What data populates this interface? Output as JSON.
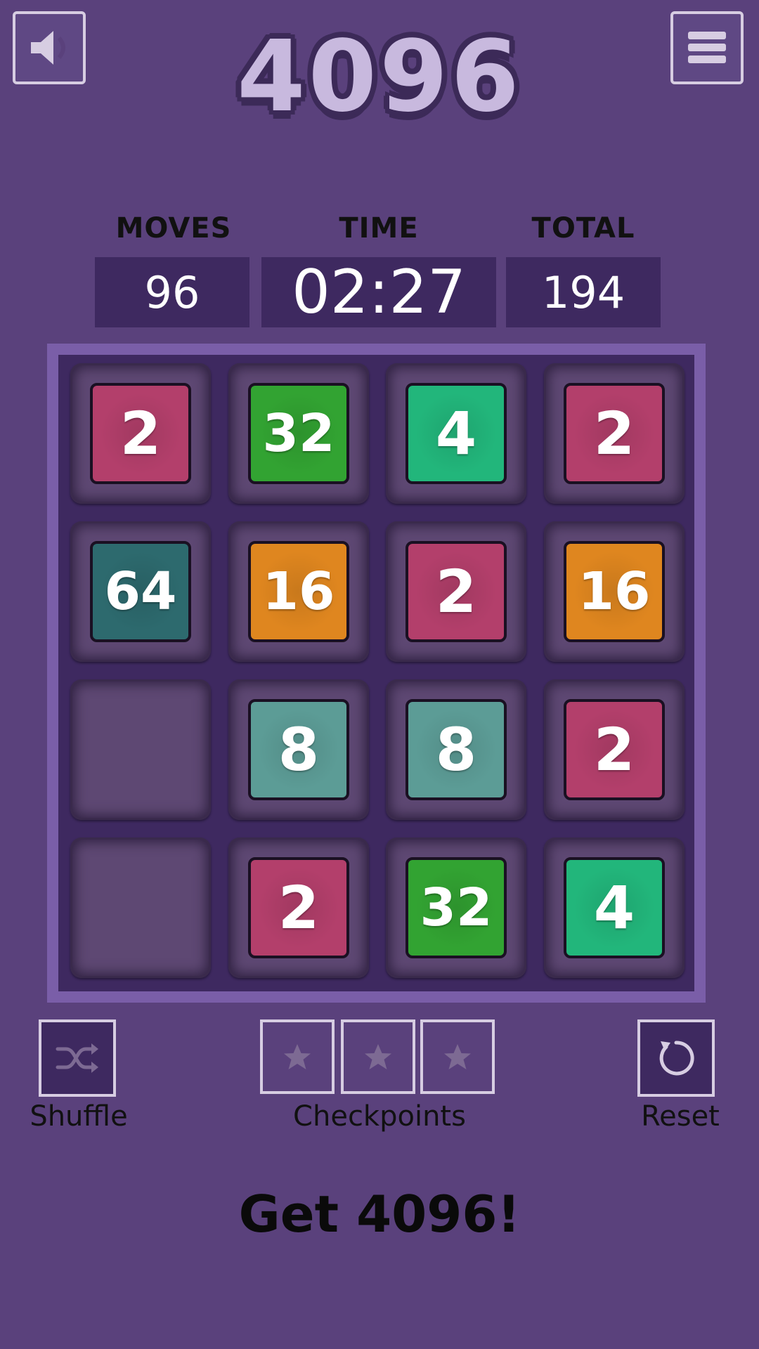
{
  "header": {
    "sound_icon": "speaker-icon",
    "menu_icon": "hamburger-menu-icon",
    "title": "4096"
  },
  "stats": {
    "moves_label": "MOVES",
    "moves_value": "96",
    "time_label": "TIME",
    "time_value": "02:27",
    "total_label": "TOTAL",
    "total_value": "194"
  },
  "board": {
    "rows": [
      [
        "2",
        "32",
        "4",
        "2"
      ],
      [
        "64",
        "16",
        "2",
        "16"
      ],
      [
        "",
        "8",
        "8",
        "2"
      ],
      [
        "",
        "2",
        "32",
        "4"
      ]
    ],
    "tile_colors": {
      "2": "#b33f6b",
      "4": "#22b67b",
      "8": "#5c9c96",
      "16": "#df861f",
      "32": "#32a332",
      "64": "#2d6a6e"
    }
  },
  "controls": {
    "shuffle_label": "Shuffle",
    "shuffle_icon": "shuffle-icon",
    "checkpoints_label": "Checkpoints",
    "checkpoint_icon": "star-icon",
    "checkpoint_count": 3,
    "reset_label": "Reset",
    "reset_icon": "reset-icon"
  },
  "footer": {
    "goal_text": "Get 4096!"
  }
}
